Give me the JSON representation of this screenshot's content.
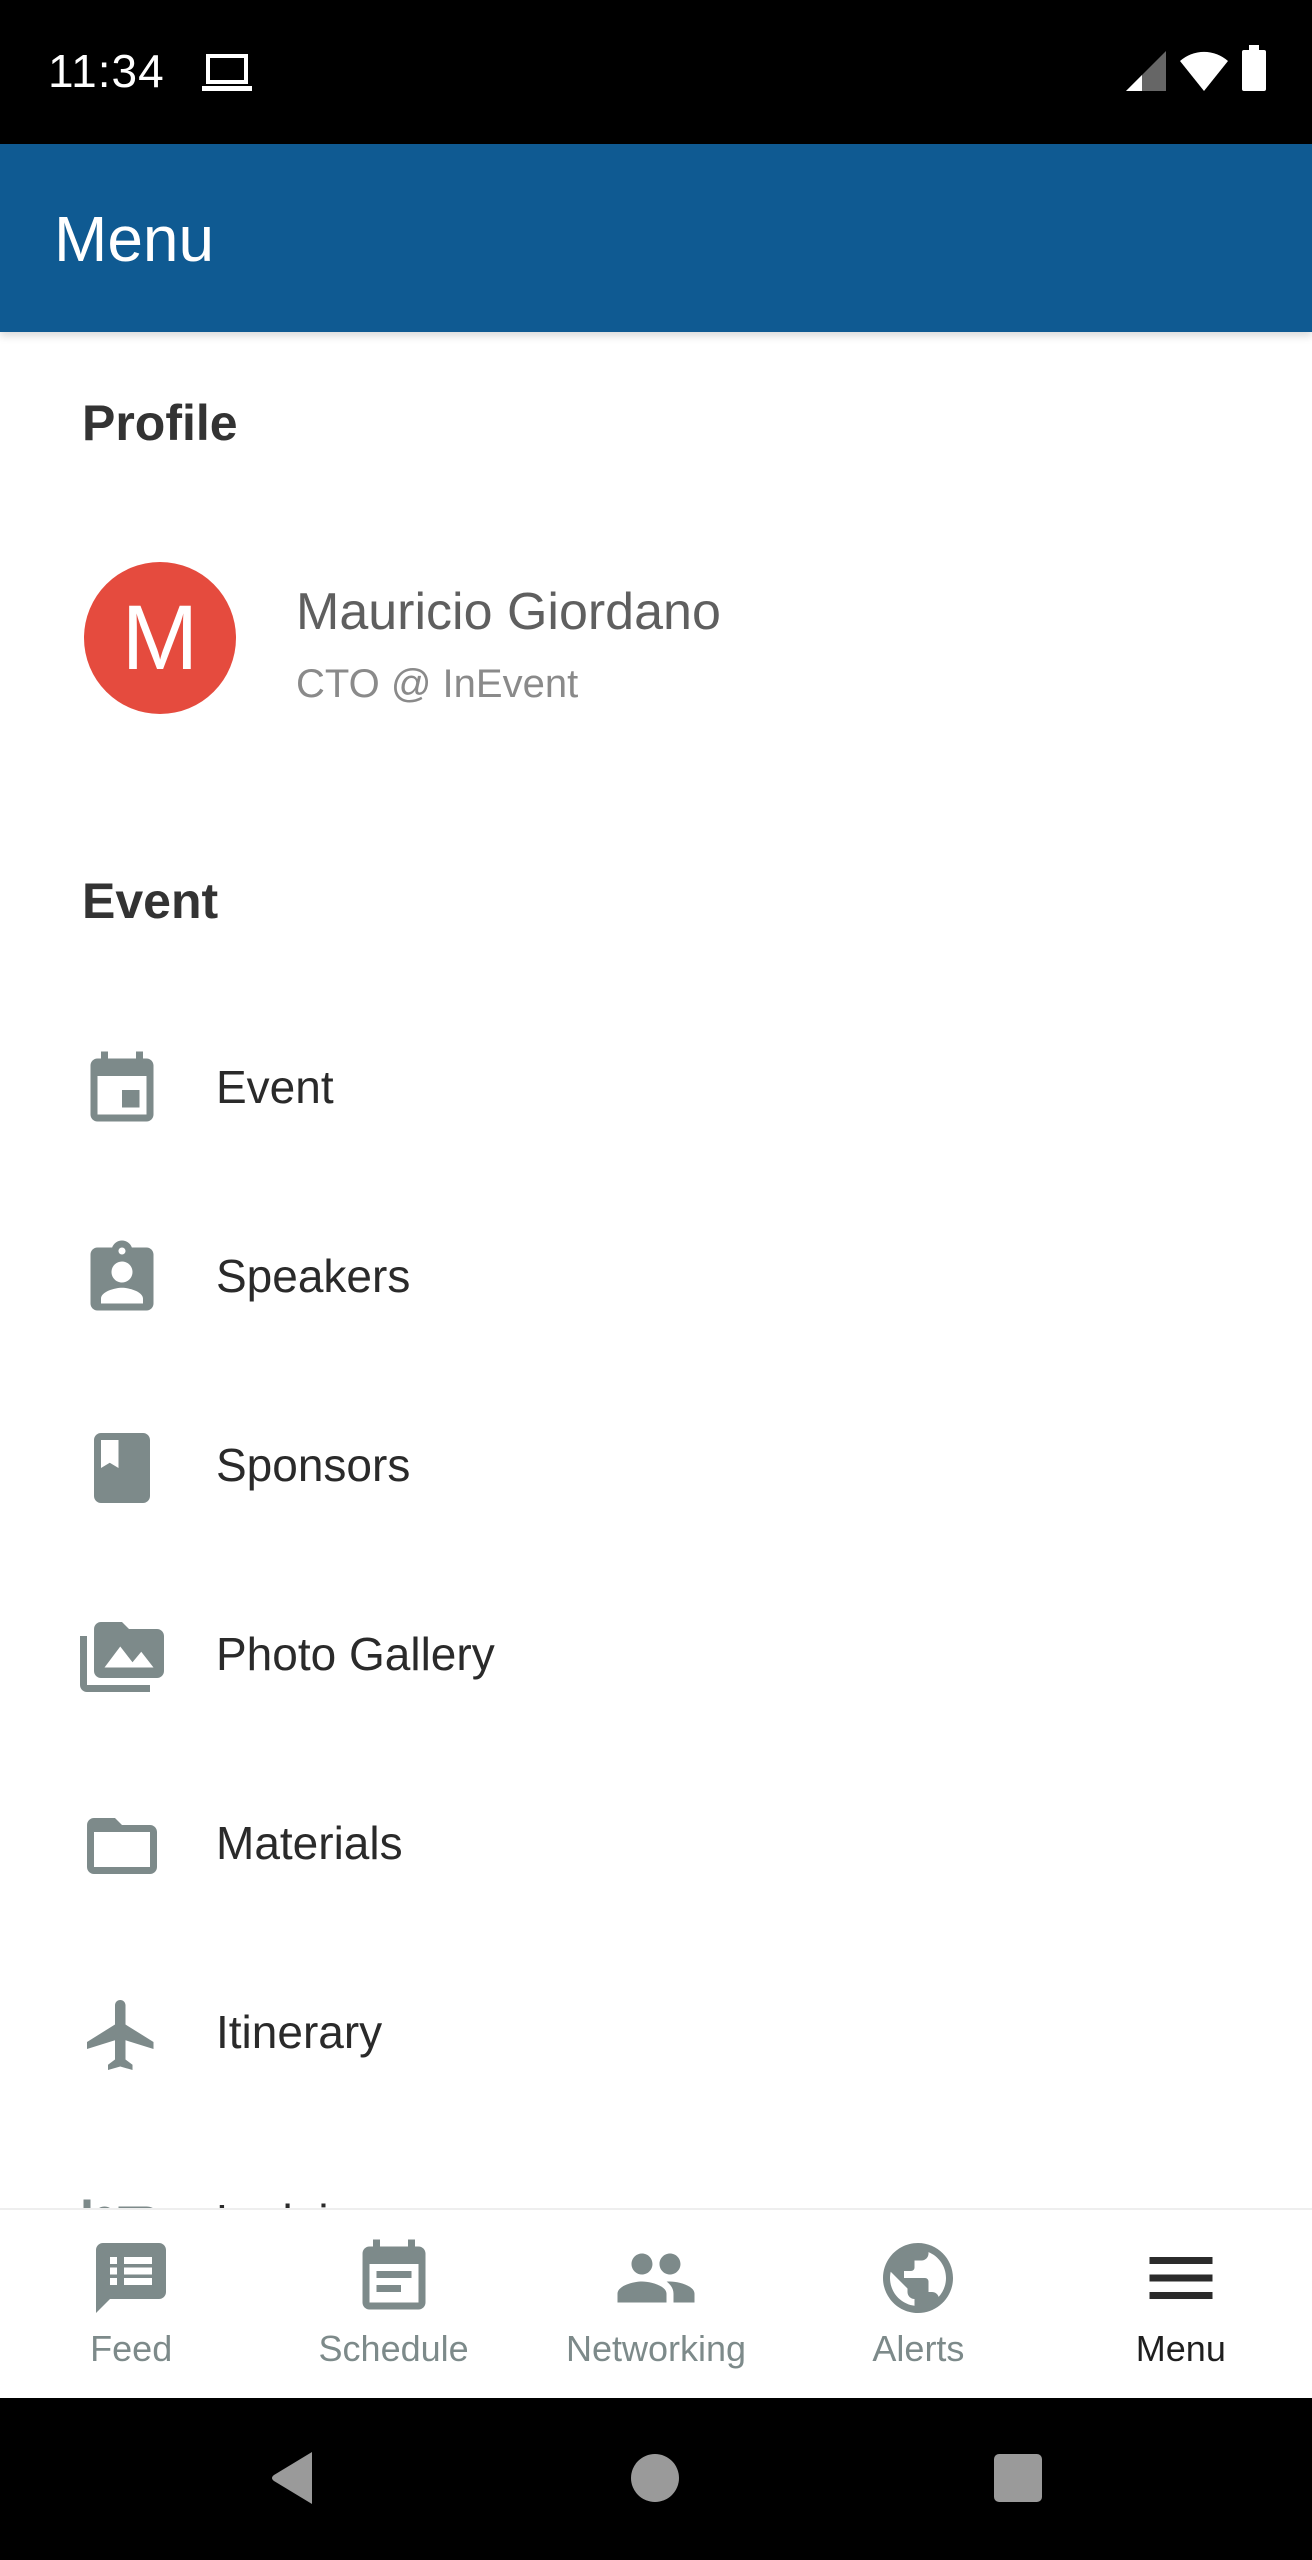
{
  "status_bar": {
    "time": "11:34",
    "left_icons": [
      "laptop-cast-icon"
    ],
    "right_icons": [
      "signal-icon",
      "wifi-icon",
      "battery-icon"
    ]
  },
  "app_bar": {
    "title": "Menu",
    "color": "#0F5A92"
  },
  "profile": {
    "section_title": "Profile",
    "avatar_initial": "M",
    "avatar_color": "#E54B3E",
    "name": "Mauricio Giordano",
    "role": "CTO @ InEvent"
  },
  "event_section": {
    "section_title": "Event",
    "items": [
      {
        "label": "Event",
        "icon": "calendar-event-icon"
      },
      {
        "label": "Speakers",
        "icon": "badge-person-icon"
      },
      {
        "label": "Sponsors",
        "icon": "book-bookmark-icon"
      },
      {
        "label": "Photo Gallery",
        "icon": "photo-library-icon"
      },
      {
        "label": "Materials",
        "icon": "folder-icon"
      },
      {
        "label": "Itinerary",
        "icon": "airplane-icon"
      },
      {
        "label": "Lodging",
        "icon": "bed-icon"
      }
    ]
  },
  "bottom_nav": {
    "items": [
      {
        "label": "Feed",
        "icon": "feed-icon",
        "active": false
      },
      {
        "label": "Schedule",
        "icon": "schedule-icon",
        "active": false
      },
      {
        "label": "Networking",
        "icon": "people-icon",
        "active": false
      },
      {
        "label": "Alerts",
        "icon": "globe-icon",
        "active": false
      },
      {
        "label": "Menu",
        "icon": "hamburger-menu-icon",
        "active": true
      }
    ],
    "icon_color": "#7D8A8A",
    "active_color": "#1F1F1F"
  },
  "system_nav": {
    "buttons": [
      "back",
      "home",
      "recents"
    ]
  }
}
